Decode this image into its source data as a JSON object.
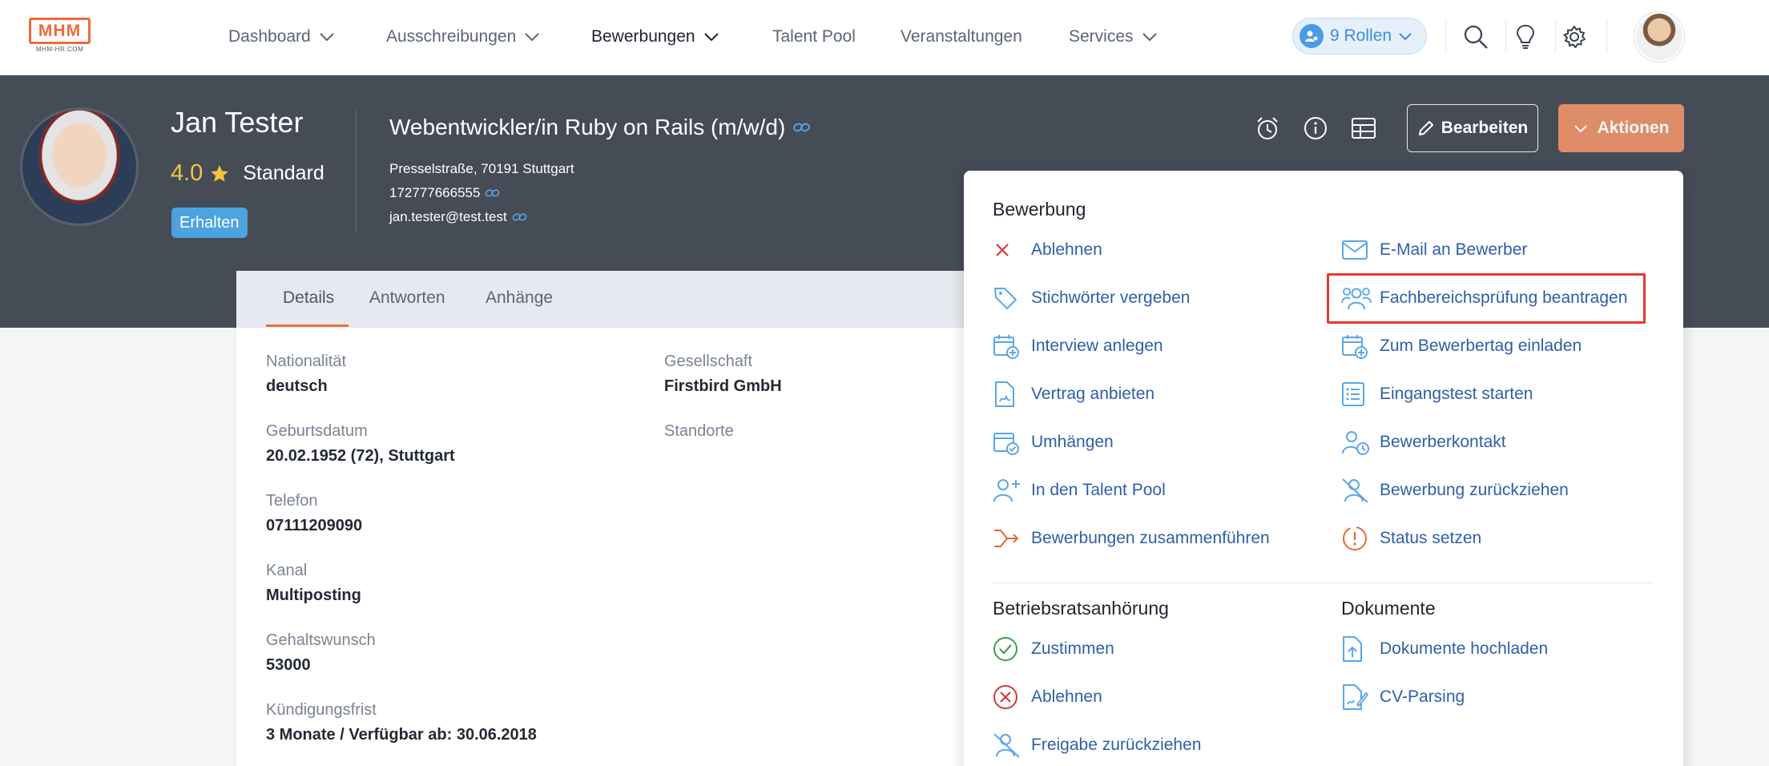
{
  "nav": {
    "logo_text": "MHM",
    "logo_sub": "MHM-HR.COM",
    "items": [
      {
        "label": "Dashboard",
        "dropdown": true
      },
      {
        "label": "Ausschreibungen",
        "dropdown": true
      },
      {
        "label": "Bewerbungen",
        "dropdown": true,
        "active": true
      },
      {
        "label": "Talent Pool",
        "dropdown": false
      },
      {
        "label": "Veranstaltungen",
        "dropdown": false
      },
      {
        "label": "Services",
        "dropdown": true
      }
    ],
    "roles_label": "9 Rollen",
    "icons": [
      "search-icon",
      "lightbulb-icon",
      "gear-icon"
    ]
  },
  "candidate": {
    "name": "Jan Tester",
    "rating": "4.0",
    "level": "Standard",
    "status_badge": "Erhalten",
    "job_title": "Webentwickler/in Ruby on Rails (m/w/d)",
    "address": "Presselstraße, 70191 Stuttgart",
    "phone": "172777666555",
    "email": "jan.tester@test.test"
  },
  "header_actions": {
    "edit_label": "Bearbeiten",
    "actions_label": "Aktionen"
  },
  "tabs": [
    "Details",
    "Antworten",
    "Anhänge"
  ],
  "details": {
    "left": [
      {
        "label": "Nationalität",
        "value": "deutsch"
      },
      {
        "label": "Geburtsdatum",
        "value": "20.02.1952 (72), Stuttgart"
      },
      {
        "label": "Telefon",
        "value": "07111209090"
      },
      {
        "label": "Kanal",
        "value": "Multiposting"
      },
      {
        "label": "Gehaltswunsch",
        "value": "53000"
      },
      {
        "label": "Kündigungsfrist",
        "value": "3 Monate / Verfügbar ab: 30.06.2018"
      }
    ],
    "right": [
      {
        "label": "Gesellschaft",
        "value": "Firstbird GmbH"
      },
      {
        "label": "Standorte",
        "value": ""
      }
    ]
  },
  "menu": {
    "section_bewerbung": "Bewerbung",
    "bewerbung_left": [
      {
        "label": "Ablehnen",
        "icon": "x-icon"
      },
      {
        "label": "Stichwörter vergeben",
        "icon": "tag-icon"
      },
      {
        "label": "Interview anlegen",
        "icon": "calendar-plus-icon"
      },
      {
        "label": "Vertrag anbieten",
        "icon": "contract-icon"
      },
      {
        "label": "Umhängen",
        "icon": "calendar-check-icon"
      },
      {
        "label": "In den Talent Pool",
        "icon": "user-plus-icon"
      },
      {
        "label": "Bewerbungen zusammenführen",
        "icon": "merge-icon"
      }
    ],
    "bewerbung_right": [
      {
        "label": "E-Mail an Bewerber",
        "icon": "mail-icon"
      },
      {
        "label": "Fachbereichsprüfung beantragen",
        "icon": "users-icon"
      },
      {
        "label": "Zum Bewerbertag einladen",
        "icon": "calendar-plus-icon"
      },
      {
        "label": "Eingangstest starten",
        "icon": "checklist-icon"
      },
      {
        "label": "Bewerberkontakt",
        "icon": "user-clock-icon"
      },
      {
        "label": "Bewerbung zurückziehen",
        "icon": "user-slash-icon"
      },
      {
        "label": "Status setzen",
        "icon": "status-alert-icon"
      }
    ],
    "section_betriebsrat": "Betriebsratsanhörung",
    "betriebsrat": [
      {
        "label": "Zustimmen",
        "icon": "check-circle-icon"
      },
      {
        "label": "Ablehnen",
        "icon": "x-circle-icon"
      },
      {
        "label": "Freigabe zurückziehen",
        "icon": "user-slash-icon"
      }
    ],
    "section_dokumente": "Dokumente",
    "dokumente": [
      {
        "label": "Dokumente hochladen",
        "icon": "upload-doc-icon"
      },
      {
        "label": "CV-Parsing",
        "icon": "cv-parse-icon"
      }
    ],
    "highlighted": "Fachbereichsprüfung beantragen"
  },
  "colors": {
    "accent": "#e8733f",
    "link": "#2e5fa8",
    "header_band": "#454c56",
    "highlight": "#e53a2f"
  }
}
